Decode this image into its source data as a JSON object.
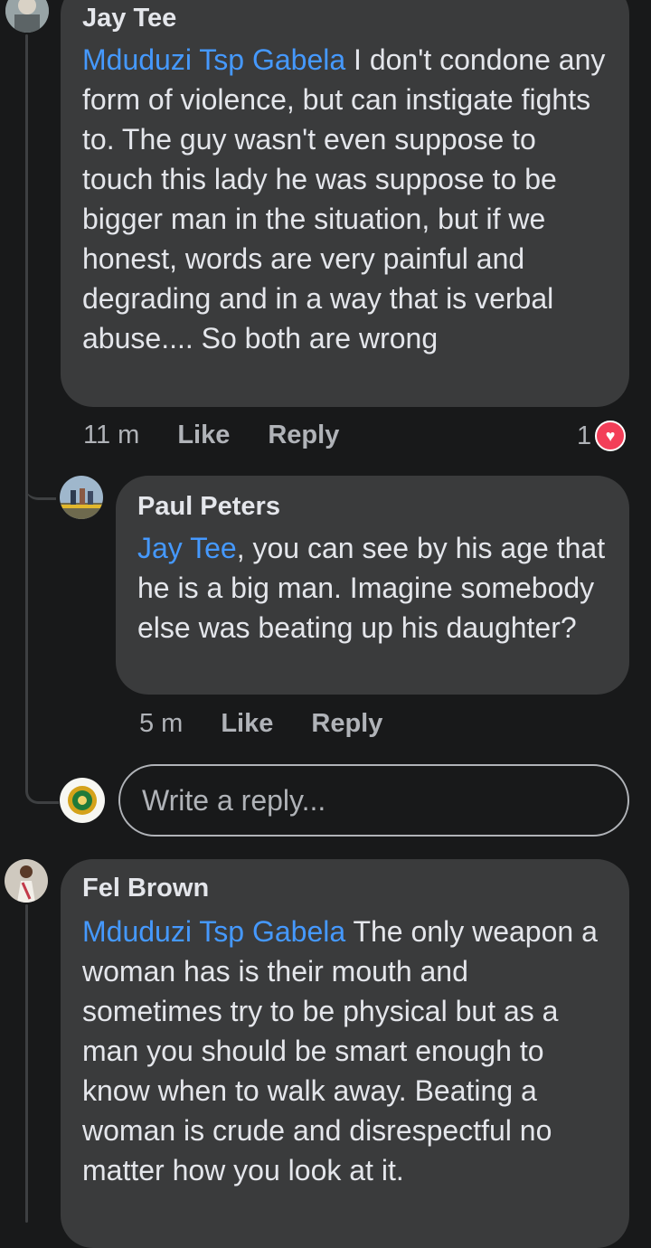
{
  "comments": [
    {
      "author": "Jay Tee",
      "mention": "Mduduzi Tsp Gabela",
      "body": " I don't condone any form of violence, but can instigate fights to. The guy wasn't even suppose to touch this lady he was suppose to be bigger man in the situation, but if we honest, words are very painful and degrading and in a way that is verbal abuse.... So both are wrong",
      "time": "11 m",
      "like_label": "Like",
      "reply_label": "Reply",
      "reaction_count": "1",
      "reaction_icon": "heart-icon"
    },
    {
      "author": "Paul Peters",
      "mention": "Jay Tee",
      "body": ", you can see by his age that he is a big man. Imagine somebody else was beating up his daughter?",
      "time": "5 m",
      "like_label": "Like",
      "reply_label": "Reply"
    },
    {
      "author": "Fel Brown",
      "mention": "Mduduzi Tsp Gabela",
      "body": " The only weapon a woman has is their mouth and sometimes try to be physical but as a man you should be smart enough to know when to walk away. Beating a woman is crude and disrespectful no matter how you look at it."
    }
  ],
  "reply_input": {
    "placeholder": "Write a reply..."
  },
  "colors": {
    "background": "#18191a",
    "bubble": "#3a3b3c",
    "mention": "#4599ff",
    "meta_text": "#b0b3b8",
    "heart": "#f33e58"
  }
}
